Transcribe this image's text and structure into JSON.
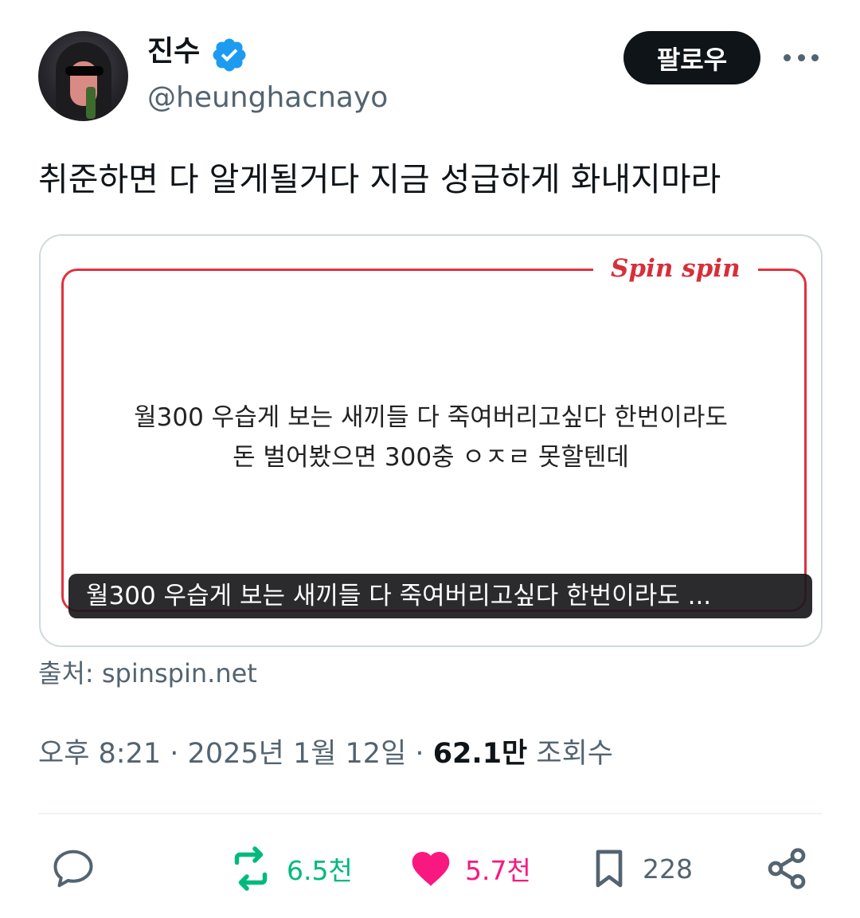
{
  "author": {
    "name": "진수",
    "handle": "@heunghacnayo",
    "follow_label": "팔로우"
  },
  "tweet": {
    "text": "취준하면 다 알게될거다 지금 성급하게 화내지마라"
  },
  "card": {
    "brand": "Spin spin",
    "line1": "월300 우습게 보는 새끼들 다 죽여버리고싶다 한번이라도",
    "line2": "돈 벌어봤으면 300충 ㅇㅈㄹ 못할텐데",
    "caption": "월300 우습게 보는 새끼들 다 죽여버리고싶다 한번이라도 ...",
    "source": "출처: spinspin.net"
  },
  "meta": {
    "time": "오후 8:21",
    "separator": "·",
    "date": "2025년 1월 12일",
    "views_count": "62.1만",
    "views_label": "조회수"
  },
  "actions": {
    "retweet_count": "6.5천",
    "like_count": "5.7천",
    "bookmark_count": "228"
  },
  "colors": {
    "retweet": "#00ba7c",
    "like": "#f91880",
    "muted": "#536471",
    "verified": "#1d9bf0",
    "brand": "#d6303b"
  },
  "icons": [
    "reply-icon",
    "retweet-icon",
    "heart-icon",
    "bookmark-icon",
    "share-icon",
    "verified-badge-icon",
    "more-icon"
  ]
}
